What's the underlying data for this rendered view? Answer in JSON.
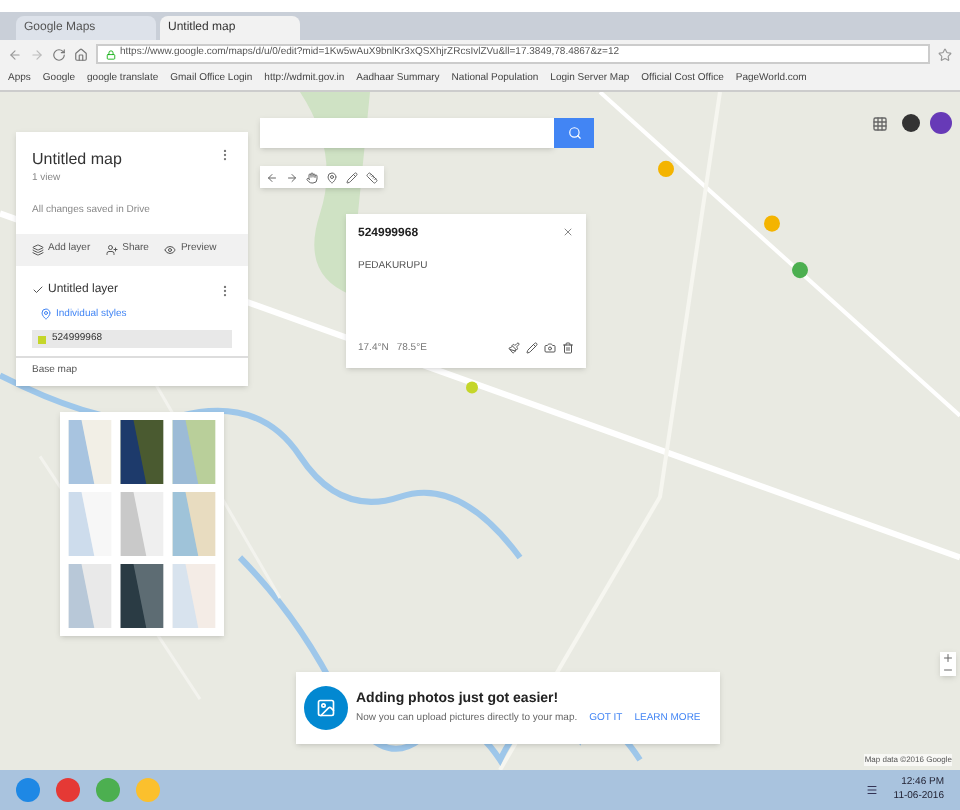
{
  "browser": {
    "tabs": [
      {
        "title": "Google Maps",
        "selected": false
      },
      {
        "title": "Untitled map",
        "selected": true
      }
    ],
    "url": "https://www.google.com/maps/d/u/0/edit?mid=1Kw5wAuX9bnlKr3xQSXhjrZRcsIvlZVu&ll=17.3849,78.4867&z=12",
    "bookmarks": [
      "Apps",
      "Google",
      "google translate",
      "Gmail Office Login",
      "http://wdmit.gov.in",
      "Aadhaar Summary",
      "National Population",
      "Login Server Map",
      "Official Cost Office",
      "PageWorld.com"
    ]
  },
  "map_panel": {
    "title": "Untitled map",
    "views": "1 view",
    "status": "All changes saved in Drive",
    "actions": [
      "Add layer",
      "Share",
      "Preview"
    ],
    "layer": {
      "name": "Untitled layer",
      "checked": true,
      "style": "Individual styles",
      "items": [
        {
          "label": "524999968",
          "selected": true
        }
      ]
    },
    "base_map": {
      "label": "Base map",
      "styles": [
        {
          "kind": "map"
        },
        {
          "kind": "satellite"
        },
        {
          "kind": "terrain"
        },
        {
          "kind": "light"
        },
        {
          "kind": "mono"
        },
        {
          "kind": "political"
        },
        {
          "kind": "landmass"
        },
        {
          "kind": "dark"
        },
        {
          "kind": "water"
        }
      ]
    }
  },
  "popup": {
    "title": "524999968",
    "body": "PEDAKURUPU",
    "lat": "17.4°N",
    "lng": "78.5°E"
  },
  "notification": {
    "title": "Adding photos just got easier!",
    "text": "Now you can upload pictures directly to your map.",
    "buttons": [
      "GOT IT",
      "LEARN MORE"
    ]
  },
  "attribution": "Map data ©2016 Google",
  "taskbar": {
    "time": "12:46 PM",
    "date": "11-06-2016"
  }
}
